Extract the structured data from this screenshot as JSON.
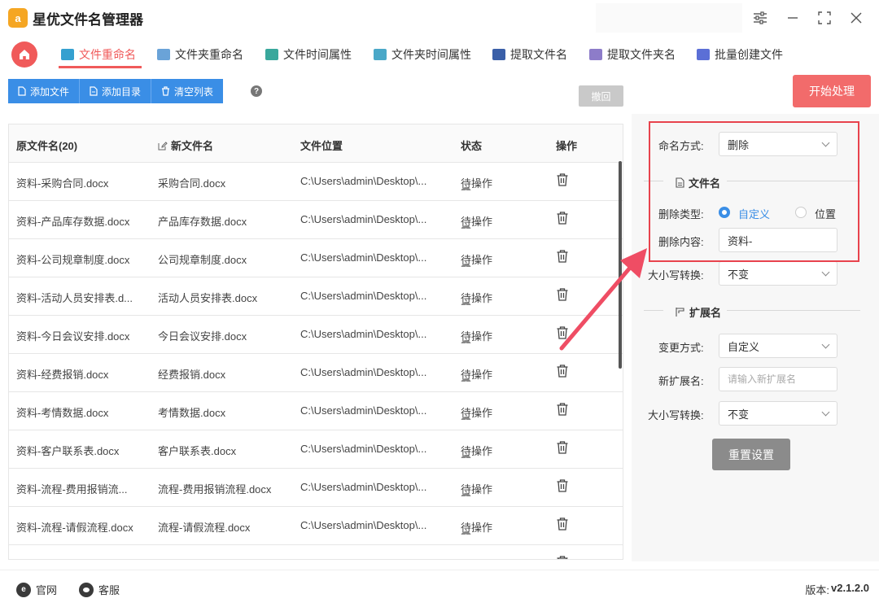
{
  "app": {
    "title": "星优文件名管理器"
  },
  "tabs": [
    {
      "label": "文件重命名",
      "icon": "rename-icon",
      "color": "#35a0d0"
    },
    {
      "label": "文件夹重命名",
      "icon": "folder-rename-icon",
      "color": "#6aa3d8"
    },
    {
      "label": "文件时间属性",
      "icon": "file-time-icon",
      "color": "#39a89c"
    },
    {
      "label": "文件夹时间属性",
      "icon": "folder-time-icon",
      "color": "#4aa8c8"
    },
    {
      "label": "提取文件名",
      "icon": "extract-filename-icon",
      "color": "#3a5fa8"
    },
    {
      "label": "提取文件夹名",
      "icon": "extract-foldername-icon",
      "color": "#8d7cc9"
    },
    {
      "label": "批量创建文件",
      "icon": "batch-create-icon",
      "color": "#5b6fd6"
    }
  ],
  "toolbar": {
    "add_file": "添加文件",
    "add_dir": "添加目录",
    "clear_list": "清空列表",
    "help": "?",
    "undo": "撤回",
    "start": "开始处理"
  },
  "table": {
    "headers": {
      "original": "原文件名(20)",
      "new": "新文件名",
      "location": "文件位置",
      "status": "状态",
      "action": "操作"
    },
    "rows": [
      {
        "original": "资料-采购合同.docx",
        "new": "采购合同.docx",
        "location": "C:\\Users\\admin\\Desktop\\...",
        "status": "待操作"
      },
      {
        "original": "资料-产品库存数据.docx",
        "new": "产品库存数据.docx",
        "location": "C:\\Users\\admin\\Desktop\\...",
        "status": "待操作"
      },
      {
        "original": "资料-公司规章制度.docx",
        "new": "公司规章制度.docx",
        "location": "C:\\Users\\admin\\Desktop\\...",
        "status": "待操作"
      },
      {
        "original": "资料-活动人员安排表.d...",
        "new": "活动人员安排表.docx",
        "location": "C:\\Users\\admin\\Desktop\\...",
        "status": "待操作"
      },
      {
        "original": "资料-今日会议安排.docx",
        "new": "今日会议安排.docx",
        "location": "C:\\Users\\admin\\Desktop\\...",
        "status": "待操作"
      },
      {
        "original": "资料-经费报销.docx",
        "new": "经费报销.docx",
        "location": "C:\\Users\\admin\\Desktop\\...",
        "status": "待操作"
      },
      {
        "original": "资料-考情数据.docx",
        "new": "考情数据.docx",
        "location": "C:\\Users\\admin\\Desktop\\...",
        "status": "待操作"
      },
      {
        "original": "资料-客户联系表.docx",
        "new": "客户联系表.docx",
        "location": "C:\\Users\\admin\\Desktop\\...",
        "status": "待操作"
      },
      {
        "original": "资料-流程-费用报销流...",
        "new": "流程-费用报销流程.docx",
        "location": "C:\\Users\\admin\\Desktop\\...",
        "status": "待操作"
      },
      {
        "original": "资料-流程-请假流程.docx",
        "new": "流程-请假流程.docx",
        "location": "C:\\Users\\admin\\Desktop\\...",
        "status": "待操作"
      },
      {
        "original": "",
        "new": "",
        "location": "",
        "status": ""
      }
    ]
  },
  "panel": {
    "naming_mode_label": "命名方式:",
    "naming_mode_value": "删除",
    "filename_section": "文件名",
    "delete_type_label": "删除类型:",
    "delete_type_custom": "自定义",
    "delete_type_position": "位置",
    "delete_content_label": "删除内容:",
    "delete_content_value": "资料-",
    "case_label": "大小写转换:",
    "case_value": "不变",
    "ext_section": "扩展名",
    "change_mode_label": "变更方式:",
    "change_mode_value": "自定义",
    "new_ext_label": "新扩展名:",
    "new_ext_placeholder": "请输入新扩展名",
    "ext_case_label": "大小写转换:",
    "ext_case_value": "不变",
    "reset": "重置设置"
  },
  "footer": {
    "website": "官网",
    "support": "客服",
    "version_label": "版本:",
    "version_value": "v2.1.2.0"
  },
  "colors": {
    "accent": "#f05a5a",
    "primary": "#3a8ee6",
    "highlight": "#e8434d"
  }
}
